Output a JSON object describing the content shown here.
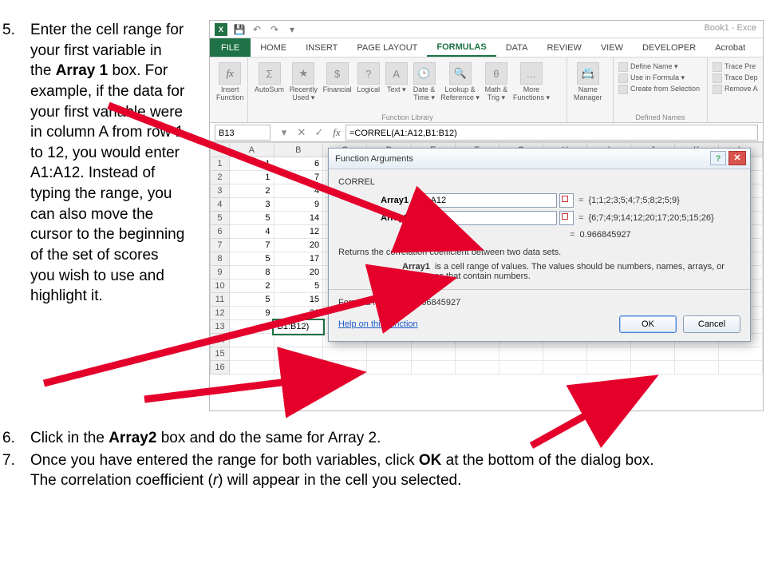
{
  "instructions": {
    "step5_num": "5.",
    "step5_a": "Enter the cell range for your first variable in the ",
    "step5_b": "Array 1",
    "step5_c": " box. For example, if the data for your first variable were in column A from row 1 to 12, you would enter A1:A12. Instead of typing the range, you can also move the cursor to the beginning of the set of scores you wish to use and highlight it.",
    "step6_num": "6.",
    "step6_a": "Click in the ",
    "step6_b": "Array2 ",
    "step6_c": "box and do the same for Array 2.",
    "step7_num": "7.",
    "step7_a": "Once you have entered the range for both variables, click ",
    "step7_b": "OK",
    "step7_c": " at the bottom of the dialog box. The correlation coefficient (",
    "step7_d": "r",
    "step7_e": ") will appear in the cell you selected."
  },
  "excel": {
    "qat": {
      "xl": "X",
      "title": "Book1 - Exce"
    },
    "tabs": {
      "file": "FILE",
      "home": "HOME",
      "insert": "INSERT",
      "pagelayout": "PAGE LAYOUT",
      "formulas": "FORMULAS",
      "data": "DATA",
      "review": "REVIEW",
      "view": "VIEW",
      "developer": "DEVELOPER",
      "acrobat": "Acrobat"
    },
    "ribbon": {
      "insertfn": "Insert\nFunction",
      "autosum": "AutoSum",
      "recent": "Recently\nUsed ▾",
      "financial": "Financial",
      "logical": "Logical",
      "text": "Text ▾",
      "datetime": "Date &\nTime ▾",
      "lookup": "Lookup &\nReference ▾",
      "math": "Math &\nTrig ▾",
      "more": "More\nFunctions ▾",
      "fnlib": "Function Library",
      "namemgr": "Name\nManager",
      "definename": "Define Name ▾",
      "useinformula": "Use in Formula ▾",
      "createfromsel": "Create from Selection",
      "definednames": "Defined Names",
      "tracepre": "Trace Pre",
      "tracedep": "Trace Dep",
      "removea": "Remove A"
    },
    "fbar": {
      "name": "B13",
      "formula": "=CORREL(A1:A12,B1:B12)"
    },
    "cols": [
      "A",
      "B",
      "C",
      "D",
      "E",
      "F",
      "G",
      "H",
      "I",
      "J",
      "K",
      "L"
    ],
    "rows": [
      {
        "n": "1",
        "a": "1",
        "b": "6"
      },
      {
        "n": "2",
        "a": "1",
        "b": "7"
      },
      {
        "n": "3",
        "a": "2",
        "b": "4"
      },
      {
        "n": "4",
        "a": "3",
        "b": "9"
      },
      {
        "n": "5",
        "a": "5",
        "b": "14"
      },
      {
        "n": "6",
        "a": "4",
        "b": "12"
      },
      {
        "n": "7",
        "a": "7",
        "b": "20"
      },
      {
        "n": "8",
        "a": "5",
        "b": "17"
      },
      {
        "n": "9",
        "a": "8",
        "b": "20"
      },
      {
        "n": "10",
        "a": "2",
        "b": "5"
      },
      {
        "n": "11",
        "a": "5",
        "b": "15"
      },
      {
        "n": "12",
        "a": "9",
        "b": "26"
      },
      {
        "n": "13",
        "a": "",
        "b": "B1:B12)"
      },
      {
        "n": "14",
        "a": "",
        "b": ""
      },
      {
        "n": "15",
        "a": "",
        "b": ""
      },
      {
        "n": "16",
        "a": "",
        "b": ""
      }
    ]
  },
  "dialog": {
    "title": "Function Arguments",
    "fn": "CORREL",
    "arg1_label": "Array1",
    "arg1_value": "A1:A12",
    "arg1_res": "{1;1;2;3;5;4;7;5;8;2;5;9}",
    "arg2_label": "Array2",
    "arg2_value": "B1:B12",
    "arg2_res": "{6;7;4;9;14;12;20;17;20;5;15;26}",
    "eq": "=",
    "interm": "0.966845927",
    "desc": "Returns the correlation coefficient between two data sets.",
    "argdesc_b": "Array1",
    "argdesc": "  is a cell range of values. The values should be numbers, names, arrays, or references that contain numbers.",
    "fres_label": "Formula result =   ",
    "fres": "0.966845927",
    "help": "Help on this function",
    "ok": "OK",
    "cancel": "Cancel"
  }
}
